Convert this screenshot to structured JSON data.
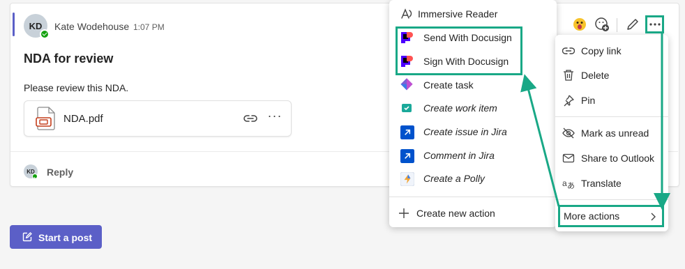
{
  "post": {
    "avatar_initials": "KD",
    "author": "Kate Wodehouse",
    "timestamp": "1:07 PM",
    "subject": "NDA for review",
    "body": "Please review this NDA.",
    "attachment": {
      "name": "NDA.pdf"
    },
    "reply_avatar_initials": "KD",
    "reply_label": "Reply"
  },
  "start_post_label": "Start a post",
  "toolbar": {
    "icons": [
      "smile-emoji-icon",
      "surprised-emoji-icon",
      "add-reaction-icon",
      "edit-icon",
      "more-options-icon"
    ]
  },
  "actions_menu": {
    "items": [
      {
        "label": "Immersive Reader",
        "icon": "immersive-reader-icon"
      },
      {
        "label": "Send With Docusign",
        "icon": "docusign-icon"
      },
      {
        "label": "Sign With Docusign",
        "icon": "docusign-icon"
      },
      {
        "label": "Create task",
        "icon": "planner-icon"
      },
      {
        "label": "Create work item",
        "icon": "work-item-icon"
      },
      {
        "label": "Create issue in Jira",
        "icon": "jira-icon"
      },
      {
        "label": "Comment in Jira",
        "icon": "jira-icon"
      },
      {
        "label": "Create a Polly",
        "icon": "polly-icon"
      }
    ],
    "create_new_action": "Create new action"
  },
  "more_menu": {
    "items": [
      {
        "label": "Copy link",
        "icon": "link-icon"
      },
      {
        "label": "Delete",
        "icon": "trash-icon"
      },
      {
        "label": "Pin",
        "icon": "pin-icon"
      },
      {
        "label": "Mark as unread",
        "icon": "eye-off-icon"
      },
      {
        "label": "Share to Outlook",
        "icon": "mail-icon"
      },
      {
        "label": "Translate",
        "icon": "translate-icon"
      }
    ],
    "more_actions": "More actions"
  },
  "colors": {
    "accent": "#5b5fc7",
    "highlight": "#19a886",
    "presence": "#13a10e"
  }
}
